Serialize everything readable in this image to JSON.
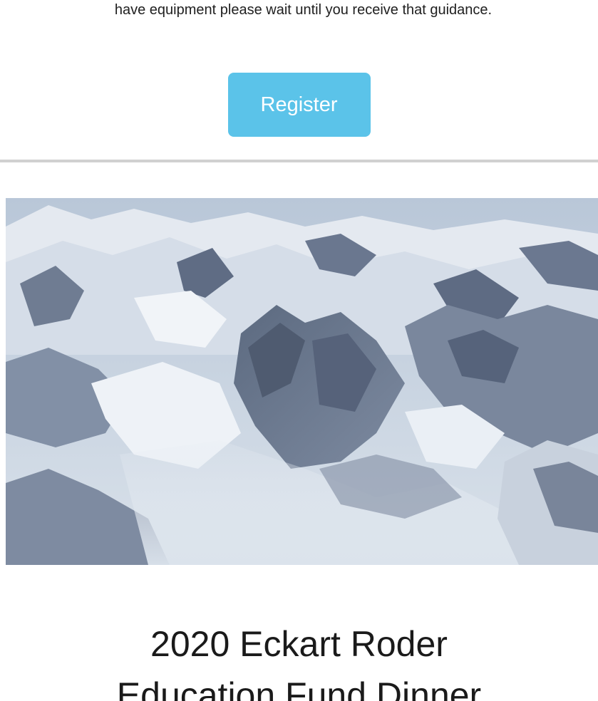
{
  "intro": {
    "text": "have equipment please wait until you receive that guidance."
  },
  "register": {
    "label": "Register",
    "color": "#5bc3e9"
  },
  "hero_image": {
    "icon": "mountain-landscape"
  },
  "event": {
    "title_line1": "2020 Eckart Roder",
    "title_line2": "Education Fund Dinner"
  }
}
